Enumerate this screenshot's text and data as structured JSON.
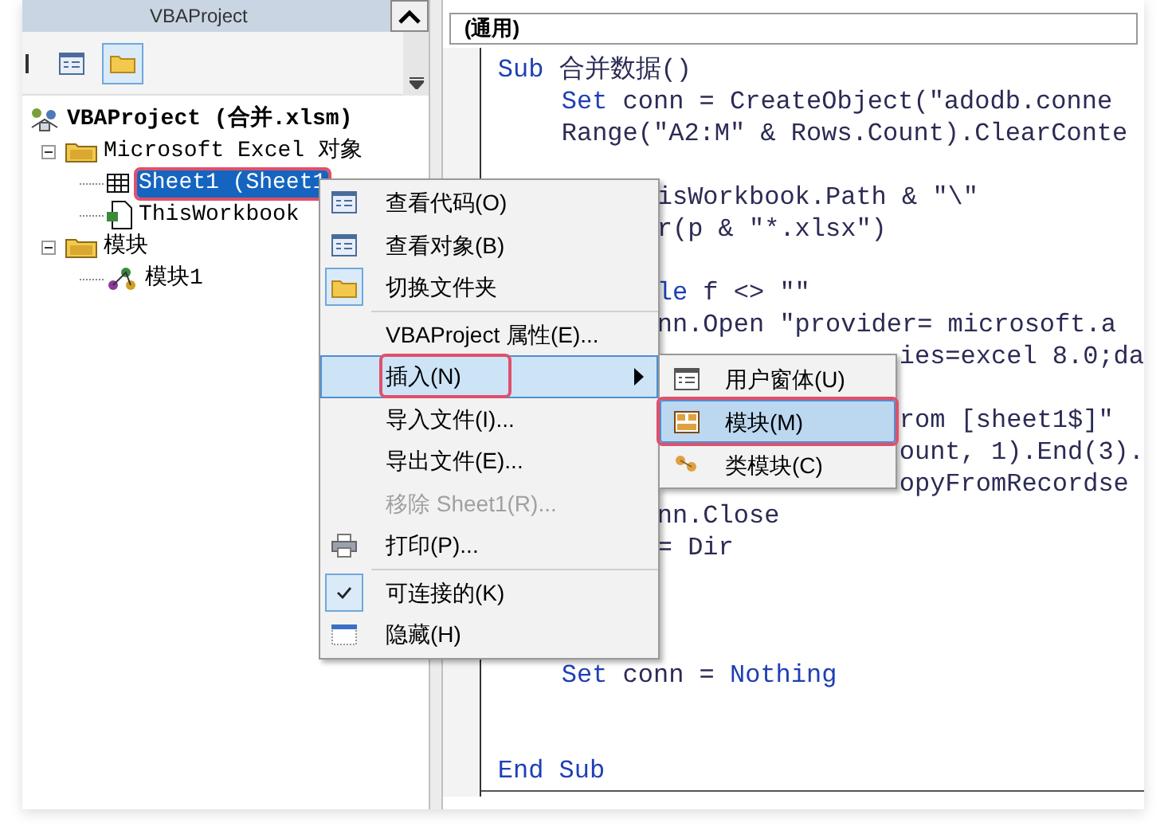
{
  "project_panel": {
    "title": "VBAProject"
  },
  "tree": [
    {
      "label": "VBAProject (合并.xlsm)",
      "kind": "project",
      "selected": false,
      "highlighted": false,
      "children": [
        {
          "label": "Microsoft Excel 对象",
          "kind": "folder",
          "expanded": true,
          "selected": false,
          "highlighted": false,
          "children": [
            {
              "label": "Sheet1 (Sheet1",
              "kind": "sheet",
              "selected": true,
              "highlighted": true
            },
            {
              "label": "ThisWorkbook",
              "kind": "workbook",
              "selected": false,
              "highlighted": false
            }
          ]
        },
        {
          "label": "模块",
          "kind": "folder",
          "expanded": true,
          "selected": false,
          "highlighted": false,
          "children": [
            {
              "label": "模块1",
              "kind": "module",
              "selected": false,
              "highlighted": false
            }
          ]
        }
      ]
    }
  ],
  "code_window": {
    "object_dropdown": "(通用)",
    "lines": [
      {
        "kind": "top",
        "parts": [
          {
            "text": "Sub",
            "kind": "keyword"
          },
          {
            "text": " 合并数据()",
            "kind": "plain"
          }
        ]
      },
      {
        "kind": "body",
        "parts": [
          {
            "text": "Set",
            "kind": "keyword"
          },
          {
            "text": " conn = CreateObject(\"adodb.conne",
            "kind": "plain"
          }
        ]
      },
      {
        "kind": "body",
        "parts": [
          {
            "text": "Range(\"A2:M\" & Rows.Count).ClearConte",
            "kind": "plain"
          }
        ]
      },
      {
        "kind": "blank"
      },
      {
        "kind": "after-menu",
        "parts": [
          {
            "text": "isWorkbook.Path & \"\\\"",
            "kind": "plain"
          }
        ]
      },
      {
        "kind": "after-menu",
        "parts": [
          {
            "text": "r(p & \"*.xlsx\")",
            "kind": "plain"
          }
        ]
      },
      {
        "kind": "blank"
      },
      {
        "kind": "after-menu",
        "parts": [
          {
            "text": "le",
            "kind": "keyword"
          },
          {
            "text": " f <> \"\"",
            "kind": "plain"
          }
        ]
      },
      {
        "kind": "after-menu",
        "parts": [
          {
            "text": "nn.Open \"provider= microsoft.a",
            "kind": "plain"
          }
        ]
      },
      {
        "kind": "after-submenu",
        "parts": [
          {
            "text": "ies=excel 8.0;da",
            "kind": "plain"
          }
        ]
      },
      {
        "kind": "blank"
      },
      {
        "kind": "after-submenu",
        "parts": [
          {
            "text": "rom [sheet1$]\"",
            "kind": "plain"
          }
        ]
      },
      {
        "kind": "after-submenu",
        "parts": [
          {
            "text": "ount, 1).End(3).",
            "kind": "plain"
          }
        ]
      },
      {
        "kind": "after-submenu",
        "parts": [
          {
            "text": "opyFromRecordse",
            "kind": "plain"
          }
        ]
      },
      {
        "kind": "after-menu",
        "parts": [
          {
            "text": "nn.Close",
            "kind": "plain"
          }
        ]
      },
      {
        "kind": "after-menu",
        "parts": [
          {
            "text": "= Dir",
            "kind": "plain"
          }
        ]
      },
      {
        "kind": "blank"
      },
      {
        "kind": "blank"
      },
      {
        "kind": "blank"
      },
      {
        "kind": "body",
        "parts": [
          {
            "text": "Set",
            "kind": "keyword"
          },
          {
            "text": " conn = ",
            "kind": "plain"
          },
          {
            "text": "Nothing",
            "kind": "keyword"
          }
        ]
      },
      {
        "kind": "blank"
      },
      {
        "kind": "blank"
      },
      {
        "kind": "top",
        "parts": [
          {
            "text": "End Sub",
            "kind": "keyword"
          }
        ]
      }
    ]
  },
  "context_menu": {
    "items": [
      {
        "kind": "item",
        "label": "查看代码(O)",
        "selected": false,
        "disabled": false,
        "checked": false,
        "highlighted": false
      },
      {
        "kind": "item",
        "label": "查看对象(B)",
        "selected": false,
        "disabled": false,
        "checked": false,
        "highlighted": false
      },
      {
        "kind": "item",
        "label": "切换文件夹",
        "selected": false,
        "disabled": false,
        "checked": true,
        "highlighted": false
      },
      {
        "kind": "separator"
      },
      {
        "kind": "item",
        "label": "VBAProject 属性(E)...",
        "selected": false,
        "disabled": false,
        "checked": false,
        "highlighted": false
      },
      {
        "kind": "submenu",
        "label": "插入(N)",
        "selected": true,
        "disabled": false,
        "checked": false,
        "highlighted": true
      },
      {
        "kind": "item",
        "label": "导入文件(I)...",
        "selected": false,
        "disabled": false,
        "checked": false,
        "highlighted": false
      },
      {
        "kind": "item",
        "label": "导出文件(E)...",
        "selected": false,
        "disabled": false,
        "checked": false,
        "highlighted": false
      },
      {
        "kind": "item",
        "label": "移除 Sheet1(R)...",
        "selected": false,
        "disabled": true,
        "checked": false,
        "highlighted": false
      },
      {
        "kind": "item",
        "label": "打印(P)...",
        "selected": false,
        "disabled": false,
        "checked": false,
        "highlighted": false
      },
      {
        "kind": "separator"
      },
      {
        "kind": "item",
        "label": "可连接的(K)",
        "selected": false,
        "disabled": false,
        "checked": true,
        "highlighted": false
      },
      {
        "kind": "item",
        "label": "隐藏(H)",
        "selected": false,
        "disabled": false,
        "checked": false,
        "highlighted": false
      }
    ]
  },
  "submenu": {
    "items": [
      {
        "label": "用户窗体(U)",
        "selected": false,
        "highlighted": false
      },
      {
        "label": "模块(M)",
        "selected": true,
        "highlighted": true
      },
      {
        "label": "类模块(C)",
        "selected": false,
        "highlighted": false
      }
    ]
  }
}
